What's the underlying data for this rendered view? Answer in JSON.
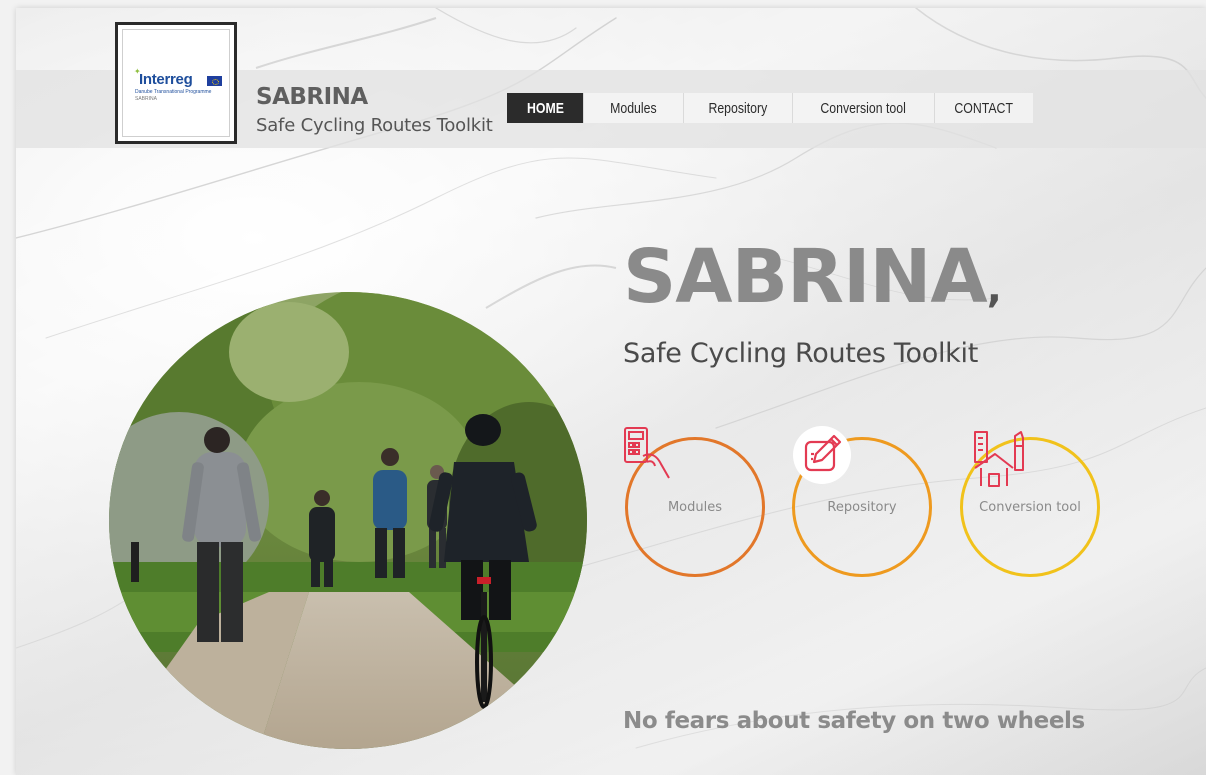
{
  "logo": {
    "brand": "Interreg",
    "program": "Danube Transnational Programme",
    "project": "SABRINA"
  },
  "site": {
    "name": "SABRINA",
    "tagline": "Safe Cycling Routes Toolkit"
  },
  "nav": {
    "items": [
      {
        "label": "HOME",
        "active": true
      },
      {
        "label": "Modules",
        "active": false
      },
      {
        "label": "Repository",
        "active": false
      },
      {
        "label": "Conversion tool",
        "active": false
      },
      {
        "label": "CONTACT",
        "active": false
      }
    ]
  },
  "hero": {
    "title": "SABRINA",
    "title_comma": ",",
    "subtitle": "Safe Cycling Routes Toolkit",
    "photo_icon": "cyclist-photo"
  },
  "features": {
    "items": [
      {
        "label": "Modules",
        "icon": "calculator-icon",
        "ring_color": "#e2772a"
      },
      {
        "label": "Repository",
        "icon": "edit-note-icon",
        "ring_color": "#ee9a1f"
      },
      {
        "label": "Conversion tool",
        "icon": "city-pencil-icon",
        "ring_color": "#f1c21b"
      }
    ],
    "icon_color": "#e33a52"
  },
  "footer_tagline": "No fears about safety on two wheels"
}
